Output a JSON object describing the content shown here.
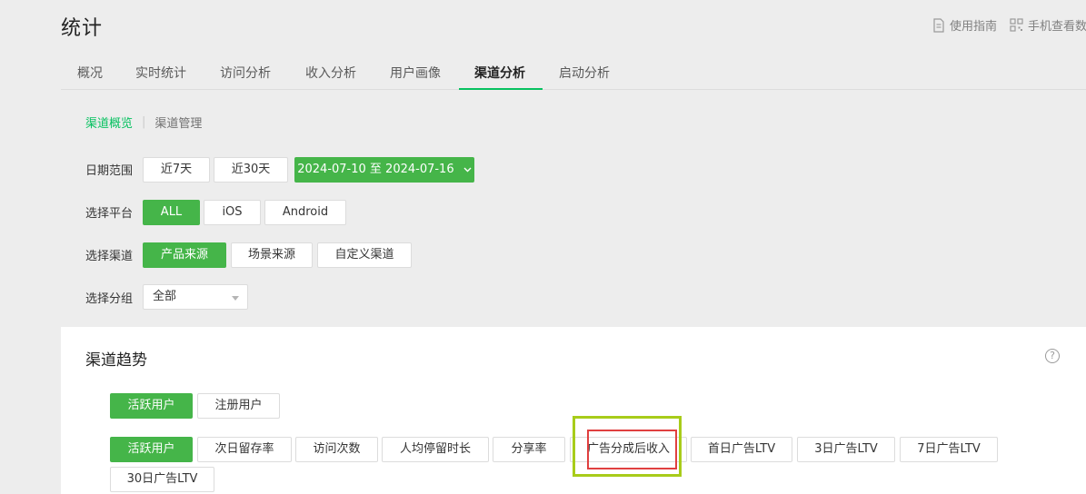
{
  "header": {
    "title": "统计"
  },
  "top_right": {
    "guide_label": "使用指南",
    "mobile_label": "手机查看数"
  },
  "tabs": [
    {
      "label": "概况"
    },
    {
      "label": "实时统计"
    },
    {
      "label": "访问分析"
    },
    {
      "label": "收入分析"
    },
    {
      "label": "用户画像"
    },
    {
      "label": "渠道分析"
    },
    {
      "label": "启动分析"
    }
  ],
  "active_tab": "渠道分析",
  "subnav": {
    "overview": "渠道概览",
    "manage": "渠道管理"
  },
  "filters": {
    "date_label": "日期范围",
    "date_buttons": [
      "近7天",
      "近30天"
    ],
    "date_range": "2024-07-10 至 2024-07-16",
    "platform_label": "选择平台",
    "platforms": [
      "ALL",
      "iOS",
      "Android"
    ],
    "channel_label": "选择渠道",
    "channels": [
      "产品来源",
      "场景来源",
      "自定义渠道"
    ],
    "group_label": "选择分组",
    "group_value": "全部"
  },
  "trend": {
    "title": "渠道趋势",
    "help": "?",
    "user_types": [
      "活跃用户",
      "注册用户"
    ],
    "metrics": [
      "活跃用户",
      "次日留存率",
      "访问次数",
      "人均停留时长",
      "分享率",
      "广告分成后收入",
      "首日广告LTV",
      "3日广告LTV",
      "7日广告LTV",
      "30日广告LTV"
    ]
  },
  "colors": {
    "accent": "#07c160",
    "button_green": "#45b549",
    "highlight_outer": "#a8cc1a",
    "highlight_inner": "#e04040"
  }
}
